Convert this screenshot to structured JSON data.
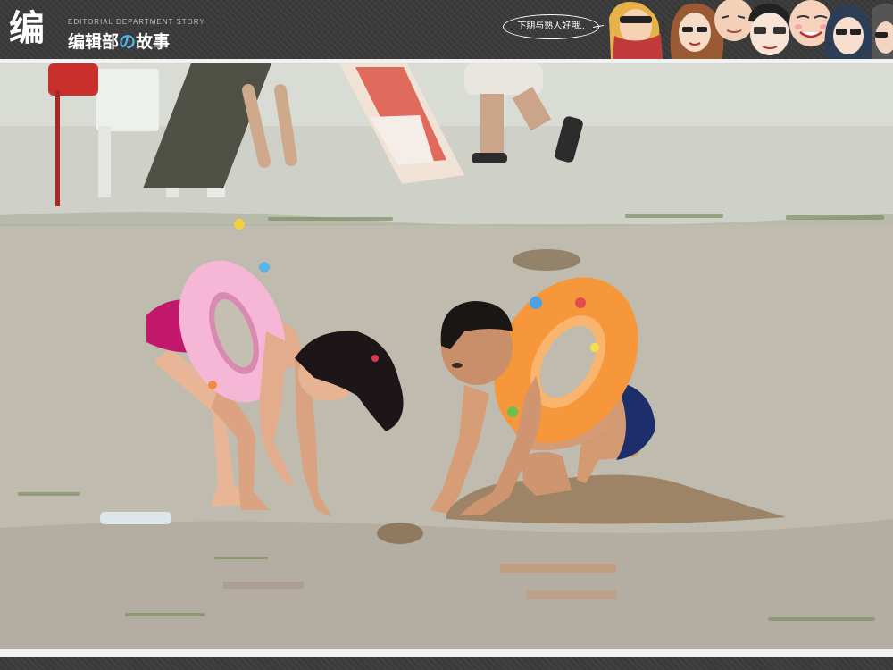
{
  "header": {
    "logo_mark": "编",
    "logo_en": "EDITORIAL DEPARTMENT STORY",
    "logo_cn_left": "编辑部",
    "logo_cn_mid": "の",
    "logo_cn_right": "故事",
    "tagline": "下期与熟人好哦.."
  },
  "photo": {
    "subject": "two children in swim rings playing in wet sand at the beach"
  }
}
